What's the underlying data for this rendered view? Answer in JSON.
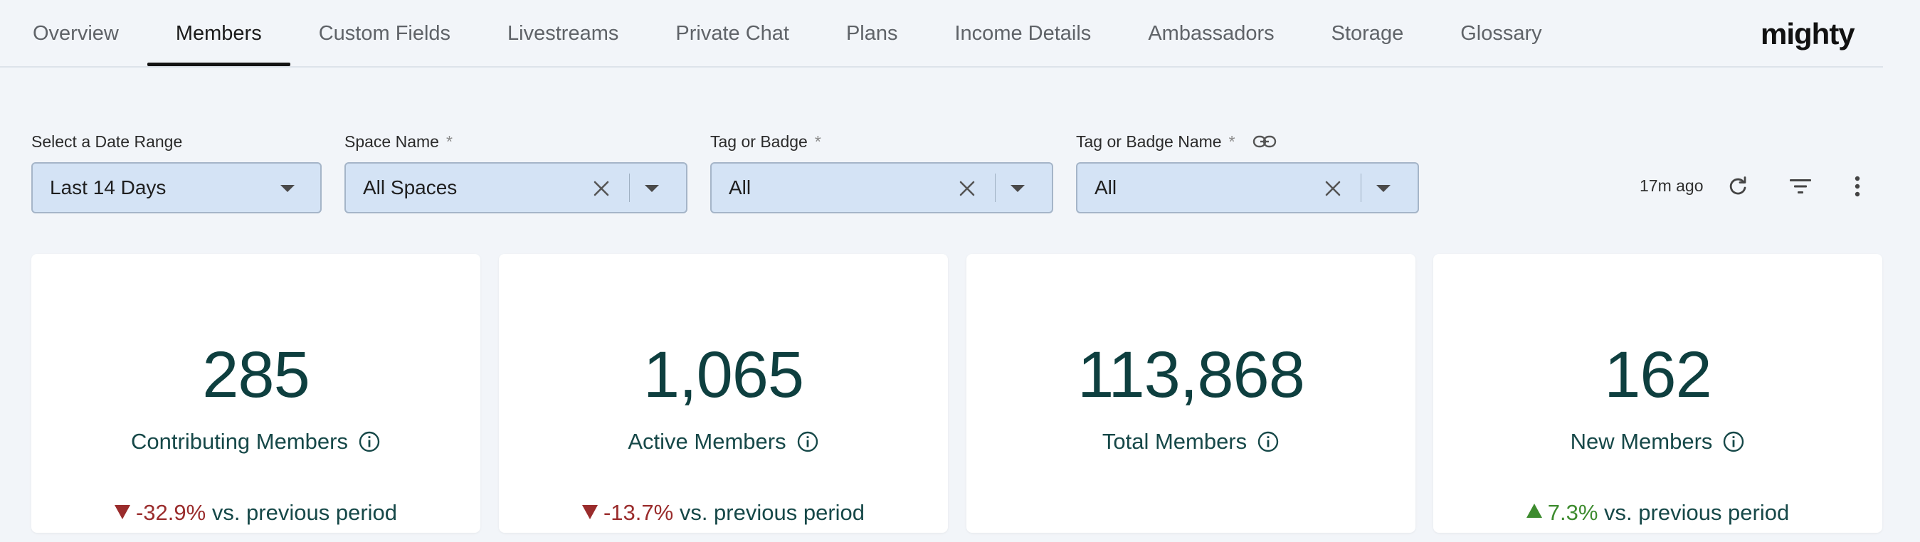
{
  "tabs": [
    {
      "label": "Overview",
      "active": false
    },
    {
      "label": "Members",
      "active": true
    },
    {
      "label": "Custom Fields",
      "active": false
    },
    {
      "label": "Livestreams",
      "active": false
    },
    {
      "label": "Private Chat",
      "active": false
    },
    {
      "label": "Plans",
      "active": false
    },
    {
      "label": "Income Details",
      "active": false
    },
    {
      "label": "Ambassadors",
      "active": false
    },
    {
      "label": "Storage",
      "active": false
    },
    {
      "label": "Glossary",
      "active": false
    }
  ],
  "brand": {
    "logo_text": "mighty"
  },
  "filters": {
    "date_range": {
      "label": "Select a Date Range",
      "value": "Last 14 Days"
    },
    "space_name": {
      "label": "Space Name",
      "required_mark": "*",
      "value": "All Spaces"
    },
    "tag_or_badge": {
      "label": "Tag or Badge",
      "required_mark": "*",
      "value": "All"
    },
    "tag_or_badge_name": {
      "label": "Tag or Badge Name",
      "required_mark": "*",
      "value": "All"
    }
  },
  "toolbar": {
    "last_updated": "17m ago"
  },
  "cards": [
    {
      "value": "285",
      "title": "Contributing Members",
      "delta": "-32.9%",
      "direction": "down",
      "comparison": "vs. previous period"
    },
    {
      "value": "1,065",
      "title": "Active Members",
      "delta": "-13.7%",
      "direction": "down",
      "comparison": "vs. previous period"
    },
    {
      "value": "113,868",
      "title": "Total Members",
      "delta": "",
      "direction": "none",
      "comparison": ""
    },
    {
      "value": "162",
      "title": "New Members",
      "delta": "7.3%",
      "direction": "up",
      "comparison": "vs. previous period"
    }
  ],
  "colors": {
    "metric_text": "#0e3f3f",
    "negative": "#9a2c2c",
    "positive": "#3d8b2e",
    "select_fill": "#d4e3f5"
  }
}
